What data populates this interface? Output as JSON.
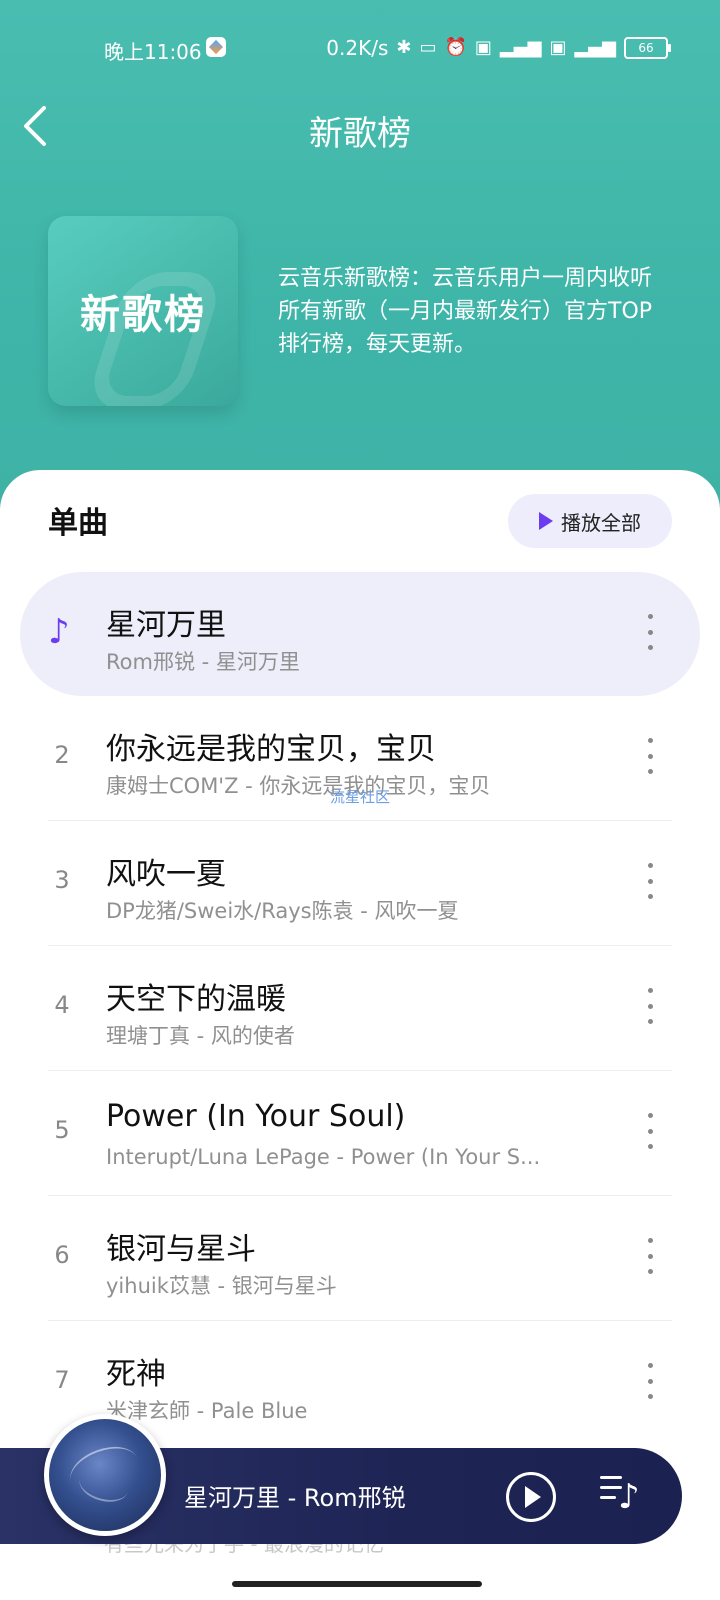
{
  "status_bar": {
    "time": "晚上11:06",
    "net_speed": "0.2K/s",
    "battery": "66",
    "icons": [
      "bluetooth-icon",
      "vibrate-icon",
      "alarm-icon",
      "hd-icon",
      "signal-4g-icon",
      "hd-icon",
      "signal-4g-icon"
    ]
  },
  "header": {
    "back_icon": "‹",
    "title": "新歌榜"
  },
  "cover": {
    "title": "新歌榜"
  },
  "description": "云音乐新歌榜：云音乐用户一周内收听所有新歌（一月内最新发行）官方TOP排行榜，每天更新。",
  "section": {
    "title": "单曲",
    "play_all_label": "播放全部"
  },
  "songs": [
    {
      "rank": "",
      "title": "星河万里",
      "subtitle": "Rom邢锐 - 星河万里",
      "playing": true
    },
    {
      "rank": "2",
      "title": "你永远是我的宝贝，宝贝",
      "subtitle": "康姆士COM'Z - 你永远是我的宝贝，宝贝"
    },
    {
      "rank": "3",
      "title": "风吹一夏",
      "subtitle": "DP龙猪/Swei水/Rays陈袁 - 风吹一夏"
    },
    {
      "rank": "4",
      "title": "天空下的温暖",
      "subtitle": "理塘丁真 - 风的使者"
    },
    {
      "rank": "5",
      "title": "Power (In Your Soul)",
      "subtitle": "Interupt/Luna LePage - Power (In Your S..."
    },
    {
      "rank": "6",
      "title": "银河与星斗",
      "subtitle": "yihuik苡慧 - 银河与星斗"
    },
    {
      "rank": "7",
      "title": "死神",
      "subtitle": "米津玄師 - Pale Blue"
    }
  ],
  "watermark": "流星社区",
  "player": {
    "now_playing": "星河万里 - Rom邢锐"
  },
  "below_peek": "有些光来为了手 - 最浪漫的记忆",
  "colors": {
    "header_teal": "#45b8ab",
    "accent_purple": "#6b3cf0",
    "active_row_bg": "#eeedfa",
    "player_bg": "#1e2454"
  }
}
